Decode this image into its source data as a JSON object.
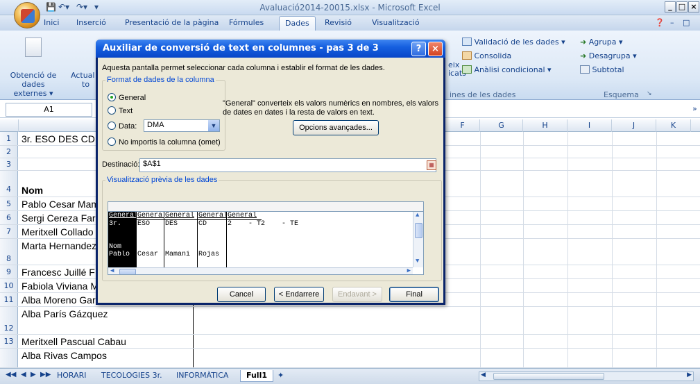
{
  "window": {
    "title": "Avaluació2014-20015.xlsx - Microsoft Excel"
  },
  "ribbon": {
    "tabs": [
      "Inici",
      "Inserció",
      "Presentació de la pàgina",
      "Fórmules",
      "Dades",
      "Revisió",
      "Visualització"
    ],
    "active_tab": "Dades",
    "left_group": {
      "button_line1": "Obtenció de",
      "button_line2": "dades externes",
      "partial": "Actual",
      "partial2": "to"
    },
    "data_tools": {
      "partial_a": "eix",
      "partial_b": "icats",
      "validation": "Validació de les dades",
      "consolidate": "Consolida",
      "whatif": "Anàlisi condicional",
      "group_label": "ines de les dades"
    },
    "outline": {
      "group": "Agrupa",
      "ungroup": "Desagrupa",
      "subtotal": "Subtotal",
      "group_label": "Esquema"
    }
  },
  "formula_bar": {
    "name_box": "A1"
  },
  "columns": [
    "F",
    "G",
    "H",
    "I",
    "J",
    "K"
  ],
  "rows": [
    {
      "num": "1",
      "text": "3r. ESO DES CD"
    },
    {
      "num": "2",
      "text": ""
    },
    {
      "num": "3",
      "text": ""
    },
    {
      "num": "4",
      "text": "Nom"
    },
    {
      "num": "5",
      "text": "Pablo Cesar Mamani"
    },
    {
      "num": "6",
      "text": "Sergi Cereza Farré"
    },
    {
      "num": "7",
      "text": "Meritxell Collado"
    },
    {
      "num": "8",
      "text": "Marta Hernandez"
    },
    {
      "num": "9",
      "text": "Francesc Juillé F"
    },
    {
      "num": "10",
      "text": "Fabiola Viviana M"
    },
    {
      "num": "11",
      "text": "Alba Moreno Garcia"
    },
    {
      "num": "12",
      "text": "Alba París Gázquez"
    },
    {
      "num": "13",
      "text": "Meritxell Pascual Cabau"
    },
    {
      "num": "",
      "text": "Alba Rivas Campos"
    }
  ],
  "sheet_tabs": [
    "HORARI",
    "TECOLOGIES 3r.",
    "INFORMÀTICA",
    "Full1"
  ],
  "active_sheet": "Full1",
  "dialog": {
    "title": "Auxiliar de conversió de text en columnes - pas 3 de 3",
    "intro": "Aquesta pantalla permet seleccionar cada columna i establir el format de les dades.",
    "format_legend": "Format de dades de la columna",
    "radio_general": "General",
    "radio_text": "Text",
    "radio_date": "Data:",
    "date_value": "DMA",
    "radio_skip": "No importis la columna (omet)",
    "description": "\"General\" converteix els valors numèrics en nombres, els valors de dates en dates i la resta de valors en text.",
    "advanced_button": "Opcions avançades...",
    "destination_label": "Destinació:",
    "destination_value": "$A$1",
    "preview_legend": "Visualització prèvia de les dades",
    "preview_columns": [
      {
        "header": "General",
        "lines": [
          "3r.",
          "",
          "",
          "Nom",
          "Pablo"
        ]
      },
      {
        "header": "General",
        "lines": [
          "ESO",
          "",
          "",
          "",
          "Cesar"
        ]
      },
      {
        "header": "General",
        "lines": [
          "DES",
          "",
          "",
          "",
          "Mamani"
        ]
      },
      {
        "header": "General",
        "lines": [
          "CD",
          "",
          "",
          "",
          "Rojas"
        ]
      },
      {
        "header": "General",
        "lines": [
          "2    - T2    - TE",
          "",
          "",
          "",
          ""
        ]
      }
    ],
    "cancel": "Cancel",
    "back": "< Endarrere",
    "next": "Endavant >",
    "finish": "Final"
  }
}
